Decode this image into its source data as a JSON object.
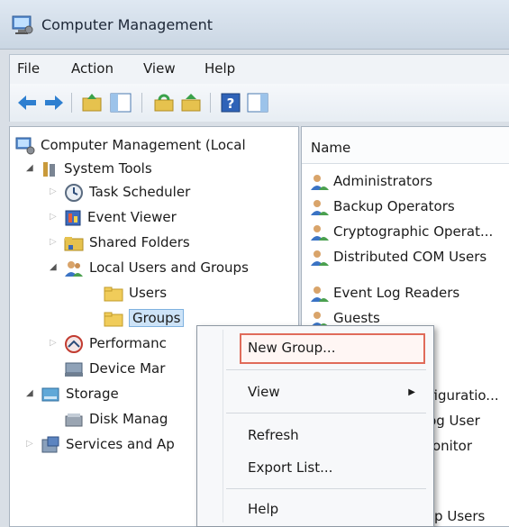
{
  "window": {
    "title": "Computer Management"
  },
  "menu": [
    "File",
    "Action",
    "View",
    "Help"
  ],
  "tree": {
    "root": "Computer Management (Local",
    "system_tools": "System Tools",
    "task_scheduler": "Task Scheduler",
    "event_viewer": "Event Viewer",
    "shared_folders": "Shared Folders",
    "local_users_groups": "Local Users and Groups",
    "users": "Users",
    "groups": "Groups",
    "performance": "Performanc",
    "device_manager": "Device Mar",
    "storage": "Storage",
    "disk_management": "Disk Manag",
    "services_apps": "Services and Ap"
  },
  "list": {
    "header": "Name",
    "items": [
      "Administrators",
      "Backup Operators",
      "Cryptographic Operat...",
      "Distributed COM Users",
      "Event Log Readers",
      "Guests"
    ],
    "partial": [
      "nfiguratio...",
      "Log User",
      "Monitor",
      "top Users"
    ]
  },
  "context_menu": {
    "new_group": "New Group...",
    "view": "View",
    "refresh": "Refresh",
    "export_list": "Export List...",
    "help": "Help"
  },
  "colors": {
    "highlight_border": "#e06b5a",
    "selection": "#cde3f7"
  }
}
